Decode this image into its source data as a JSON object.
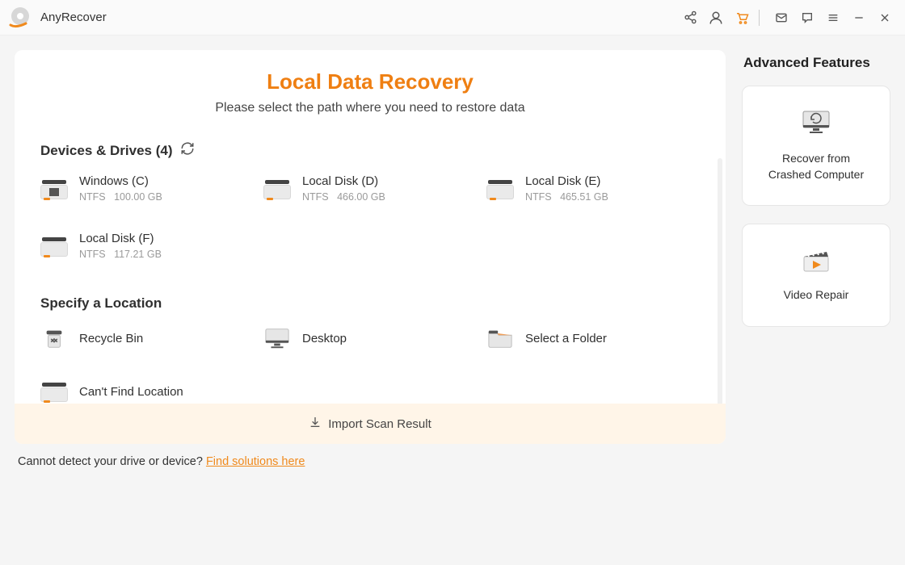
{
  "app": {
    "name": "AnyRecover"
  },
  "main": {
    "title": "Local Data Recovery",
    "subtitle": "Please select the path where you need to restore data"
  },
  "devices": {
    "heading": "Devices & Drives (4)",
    "items": [
      {
        "name": "Windows (C)",
        "fs": "NTFS",
        "size": "100.00 GB",
        "icon": "windows"
      },
      {
        "name": "Local Disk (D)",
        "fs": "NTFS",
        "size": "466.00 GB",
        "icon": "hdd"
      },
      {
        "name": "Local Disk (E)",
        "fs": "NTFS",
        "size": "465.51 GB",
        "icon": "hdd"
      },
      {
        "name": "Local Disk (F)",
        "fs": "NTFS",
        "size": "117.21 GB",
        "icon": "hdd"
      }
    ]
  },
  "locations": {
    "heading": "Specify a Location",
    "items": [
      {
        "name": "Recycle Bin",
        "icon": "recycle"
      },
      {
        "name": "Desktop",
        "icon": "desktop"
      },
      {
        "name": "Select a Folder",
        "icon": "folder"
      },
      {
        "name": "Can't Find Location",
        "icon": "hdd"
      }
    ]
  },
  "import_label": "Import Scan Result",
  "sidebar": {
    "title": "Advanced Features",
    "cards": [
      {
        "line1": "Recover from",
        "line2": "Crashed Computer"
      },
      {
        "line1": "Video Repair"
      }
    ]
  },
  "footer": {
    "prefix": "Cannot detect your drive or device? ",
    "link": "Find solutions here"
  }
}
